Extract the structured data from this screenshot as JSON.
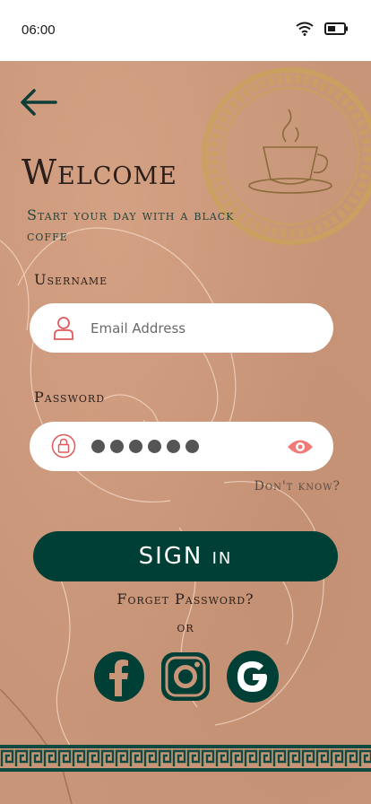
{
  "status_bar": {
    "time": "06:00",
    "icons": [
      "wifi-icon",
      "battery-icon"
    ]
  },
  "header": {
    "back_icon": "arrow-left-icon",
    "emblem": "coffee-cup-emblem"
  },
  "welcome": {
    "title": "Welcome",
    "subtitle": "Start your day with a black coffe"
  },
  "form": {
    "username_label": "Username",
    "username_placeholder": "Email Address",
    "username_icon": "user-icon",
    "password_label": "Password",
    "password_icon": "lock-icon",
    "password_masked_length": 6,
    "visibility_icon": "eye-icon",
    "dont_know": "Don't know?"
  },
  "actions": {
    "signin_label": "SIGN in",
    "forget_password": "Forget Password?",
    "or_text": "or"
  },
  "social": [
    {
      "name": "facebook",
      "icon": "facebook-icon"
    },
    {
      "name": "instagram",
      "icon": "instagram-icon"
    },
    {
      "name": "google",
      "icon": "google-icon"
    }
  ],
  "colors": {
    "primary": "#003f36",
    "background": "#c99579",
    "accent": "#e05a5a",
    "gold": "#c9a25a"
  }
}
